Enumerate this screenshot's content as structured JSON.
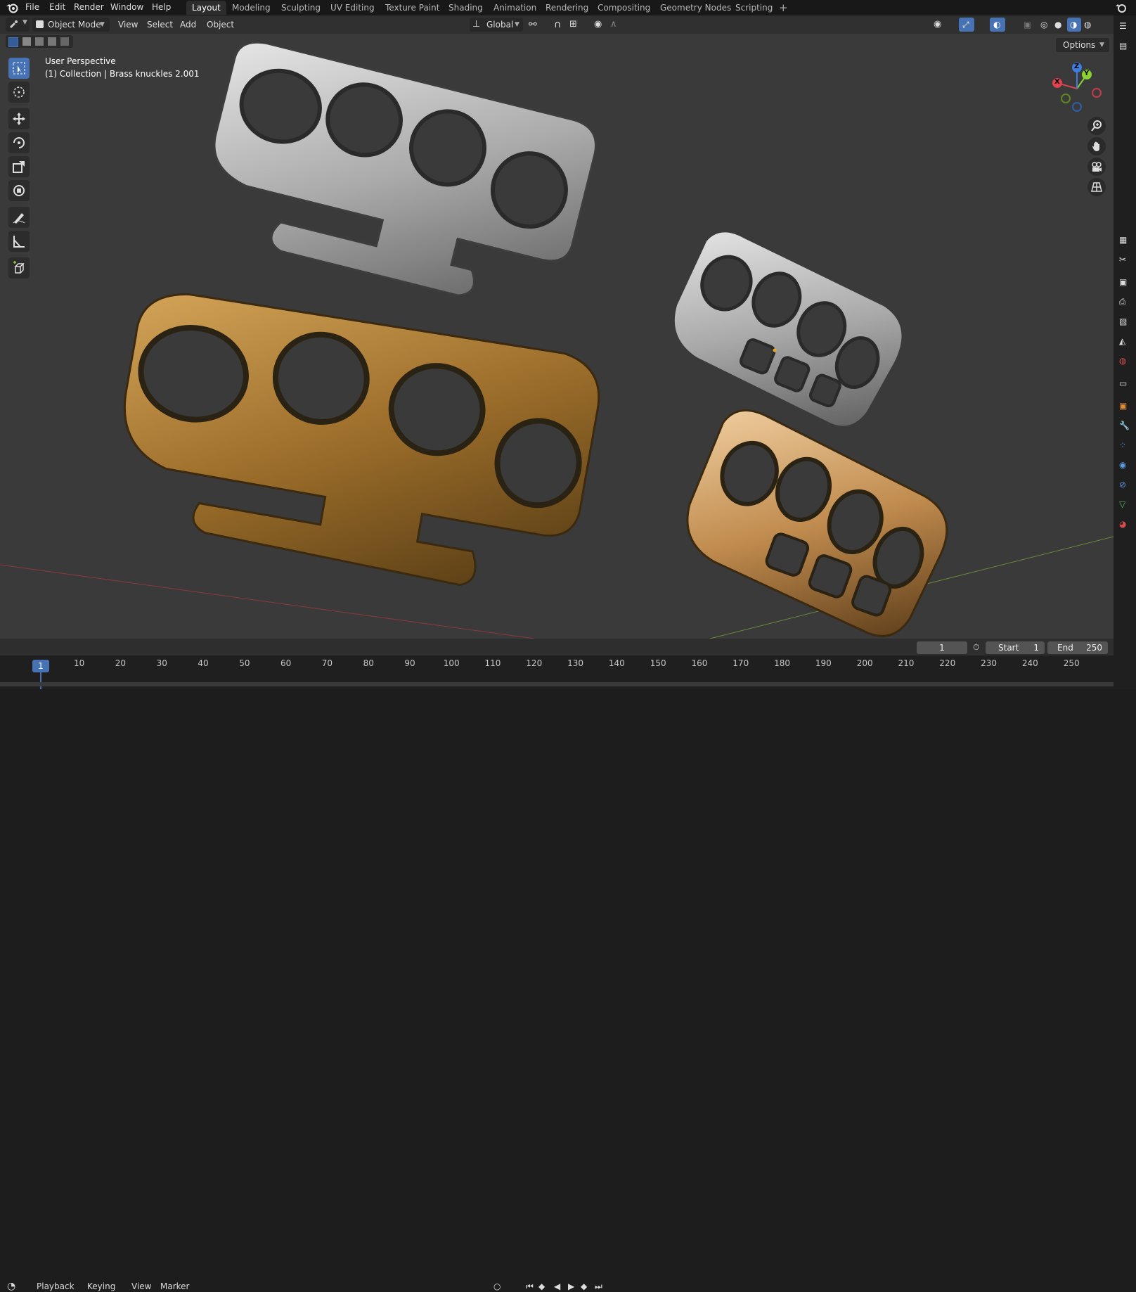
{
  "topbar": {
    "menus": [
      "File",
      "Edit",
      "Render",
      "Window",
      "Help"
    ],
    "workspaces": [
      "Layout",
      "Modeling",
      "Sculpting",
      "UV Editing",
      "Texture Paint",
      "Shading",
      "Animation",
      "Rendering",
      "Compositing",
      "Geometry Nodes",
      "Scripting"
    ],
    "active_workspace": "Layout",
    "add_workspace": "+"
  },
  "header": {
    "mode": "Object Mode",
    "menus": [
      "View",
      "Select",
      "Add",
      "Object"
    ],
    "transform_orientation": "Global",
    "options_label": "Options"
  },
  "viewport": {
    "perspective": "User Perspective",
    "collection_label": "(1) Collection | Brass knuckles 2.001",
    "gizmo_axes": [
      "X",
      "Y",
      "Z"
    ]
  },
  "timeline": {
    "menus": [
      "Playback",
      "Keying",
      "View",
      "Marker"
    ],
    "current_frame": "1",
    "start_label": "Start",
    "start_value": "1",
    "end_label": "End",
    "end_value": "250",
    "ruler_ticks": [
      "10",
      "20",
      "30",
      "40",
      "50",
      "60",
      "70",
      "80",
      "90",
      "100",
      "110",
      "120",
      "130",
      "140",
      "150",
      "160",
      "170",
      "180",
      "190",
      "200",
      "210",
      "220",
      "230",
      "240",
      "250"
    ],
    "playhead": "1"
  },
  "colors": {
    "accent": "#4772b3",
    "axis_x": "#e0424f",
    "axis_y": "#8bd12f",
    "axis_z": "#3d7de0",
    "viewport_bg": "#3a3a3a",
    "brass": "#b8863a",
    "steel": "#c9c9c9"
  },
  "icons": [
    "blender-logo-icon",
    "editor-type-icon",
    "select-box-icon",
    "cursor-icon",
    "move-icon",
    "rotate-icon",
    "scale-icon",
    "transform-icon",
    "annotate-icon",
    "measure-icon",
    "add-cube-icon",
    "zoom-icon",
    "hand-pan-icon",
    "camera-icon",
    "grid-icon"
  ]
}
